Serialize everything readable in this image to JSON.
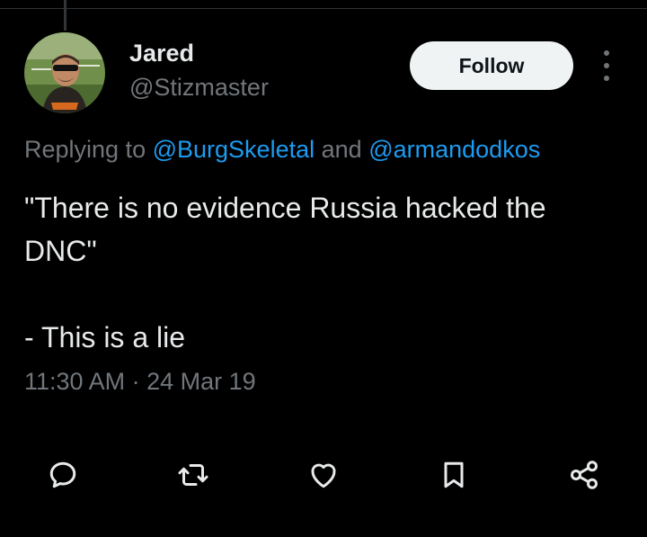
{
  "tweet": {
    "author": {
      "display_name": "Jared",
      "handle": "@Stizmaster"
    },
    "follow_label": "Follow",
    "reply_context": {
      "prefix": "Replying to",
      "mentions": [
        "@BurgSkeletal",
        "@armandodkos"
      ],
      "joiner": "and"
    },
    "text_lines": [
      "\"There is no evidence Russia hacked the",
      "DNC\"",
      "",
      "- This is a lie"
    ],
    "timestamp": "11:30 AM · 24 Mar 19"
  },
  "actions": [
    {
      "name": "reply",
      "icon": "reply-icon"
    },
    {
      "name": "retweet",
      "icon": "retweet-icon"
    },
    {
      "name": "like",
      "icon": "heart-icon"
    },
    {
      "name": "bookmark",
      "icon": "bookmark-icon"
    },
    {
      "name": "share",
      "icon": "share-icon"
    }
  ],
  "colors": {
    "background": "#000000",
    "text_primary": "#e7e9ea",
    "text_secondary": "#71767b",
    "accent": "#1d9bf0",
    "follow_button_bg": "#eff3f4"
  }
}
